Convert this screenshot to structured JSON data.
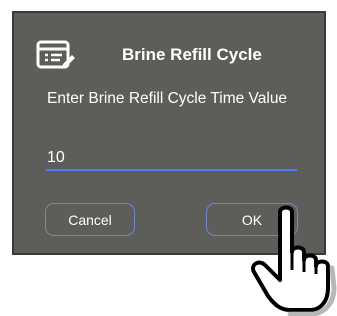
{
  "dialog": {
    "title": "Brine Refill Cycle",
    "prompt": "Enter Brine Refill Cycle Time Value",
    "input_value": "10",
    "cancel_label": "Cancel",
    "ok_label": "OK",
    "icon": "edit-document-icon",
    "pointer": "hand-pointer-icon"
  },
  "colors": {
    "dialog_background": "#5d5e5a",
    "input_underline": "#4f7cff",
    "button_border": "#6f88c9",
    "text": "#ffffff"
  }
}
